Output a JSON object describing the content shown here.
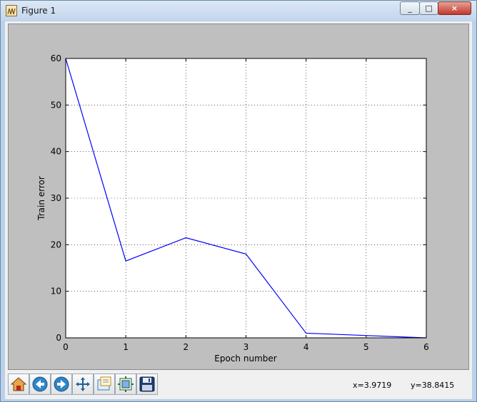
{
  "window": {
    "title": "Figure 1",
    "minimize_glyph": "_",
    "maximize_glyph": "□",
    "close_glyph": "×"
  },
  "toolbar": {
    "buttons": [
      {
        "name": "home-button",
        "icon": "home-icon"
      },
      {
        "name": "back-button",
        "icon": "back-arrow-icon"
      },
      {
        "name": "forward-button",
        "icon": "forward-arrow-icon"
      },
      {
        "name": "pan-button",
        "icon": "pan-arrows-icon"
      },
      {
        "name": "zoom-button",
        "icon": "zoom-rect-icon"
      },
      {
        "name": "subplots-button",
        "icon": "subplots-icon"
      },
      {
        "name": "save-button",
        "icon": "floppy-disk-icon"
      }
    ],
    "coord_x": "x=3.9719",
    "coord_y": "y=38.8415"
  },
  "colors": {
    "line": "#0000ff",
    "figure_bg": "#bfbfbf",
    "axes_bg": "#ffffff"
  },
  "chart_data": {
    "type": "line",
    "xlabel": "Epoch number",
    "ylabel": "Train error",
    "xlim": [
      0,
      6
    ],
    "ylim": [
      0,
      60
    ],
    "xticks": [
      0,
      1,
      2,
      3,
      4,
      5,
      6
    ],
    "yticks": [
      0,
      10,
      20,
      30,
      40,
      50,
      60
    ],
    "grid": true,
    "series": [
      {
        "x": [
          0,
          1,
          2,
          3,
          4,
          6
        ],
        "y": [
          60,
          16.5,
          21.5,
          18,
          1,
          0
        ]
      }
    ]
  }
}
